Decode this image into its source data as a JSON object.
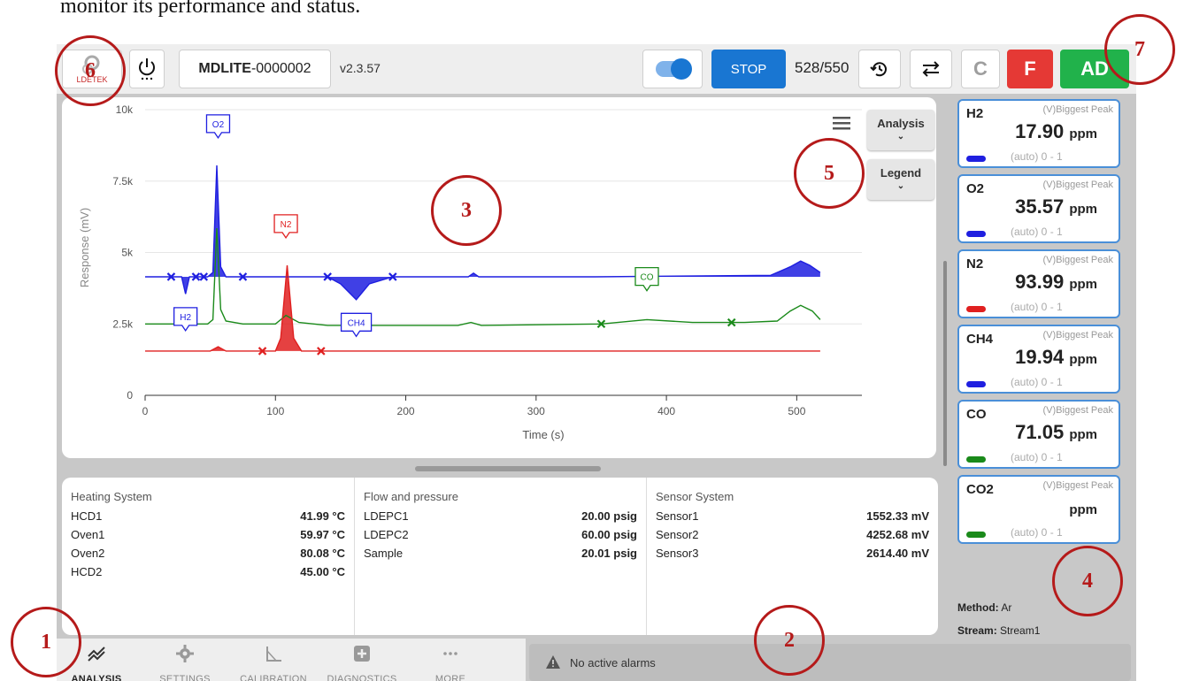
{
  "caption": "monitor its performance and status.",
  "topbar": {
    "logo_text": "LDETEK",
    "device_prefix": "MDLITE",
    "device_id": "-0000002",
    "version": "v2.3.57",
    "stop_label": "STOP",
    "counter": "528/550",
    "c_label": "C",
    "f_label": "F",
    "ad_label": "AD"
  },
  "chart": {
    "menu_icon": "hamburger-icon",
    "analysis_label": "Analysis",
    "legend_label": "Legend",
    "ylabel": "Response (mV)",
    "xlabel": "Time (s)",
    "yticks": [
      "0",
      "2.5k",
      "5k",
      "7.5k",
      "10k"
    ],
    "xticks": [
      "0",
      "100",
      "200",
      "300",
      "400",
      "500"
    ]
  },
  "chart_data": {
    "type": "line",
    "xlabel": "Time (s)",
    "ylabel": "Response (mV)",
    "xlim": [
      0,
      550
    ],
    "ylim": [
      0,
      10000
    ],
    "grid": true,
    "series": [
      {
        "color": "#1f1fe0",
        "points": [
          [
            0,
            4150
          ],
          [
            20,
            4150
          ],
          [
            28,
            4150
          ],
          [
            31,
            3550
          ],
          [
            34,
            4150
          ],
          [
            48,
            4150
          ],
          [
            52,
            4300
          ],
          [
            55,
            8050
          ],
          [
            58,
            4500
          ],
          [
            62,
            4150
          ],
          [
            140,
            4150
          ],
          [
            150,
            3900
          ],
          [
            162,
            3350
          ],
          [
            172,
            3900
          ],
          [
            190,
            4150
          ],
          [
            248,
            4150
          ],
          [
            252,
            4280
          ],
          [
            256,
            4150
          ],
          [
            345,
            4150
          ],
          [
            480,
            4200
          ],
          [
            495,
            4500
          ],
          [
            503,
            4700
          ],
          [
            510,
            4550
          ],
          [
            518,
            4300
          ]
        ]
      },
      {
        "color": "#1a8a1a",
        "points": [
          [
            0,
            2500
          ],
          [
            48,
            2500
          ],
          [
            52,
            2650
          ],
          [
            55,
            5850
          ],
          [
            58,
            3000
          ],
          [
            62,
            2600
          ],
          [
            75,
            2500
          ],
          [
            100,
            2500
          ],
          [
            108,
            2800
          ],
          [
            118,
            2550
          ],
          [
            140,
            2450
          ],
          [
            240,
            2450
          ],
          [
            250,
            2550
          ],
          [
            258,
            2450
          ],
          [
            350,
            2500
          ],
          [
            385,
            2650
          ],
          [
            420,
            2550
          ],
          [
            460,
            2550
          ],
          [
            485,
            2600
          ],
          [
            495,
            2950
          ],
          [
            503,
            3150
          ],
          [
            512,
            2950
          ],
          [
            518,
            2650
          ]
        ]
      },
      {
        "color": "#e02020",
        "points": [
          [
            0,
            1550
          ],
          [
            50,
            1550
          ],
          [
            56,
            1700
          ],
          [
            62,
            1550
          ],
          [
            100,
            1550
          ],
          [
            104,
            2000
          ],
          [
            109,
            4550
          ],
          [
            114,
            2000
          ],
          [
            120,
            1550
          ],
          [
            518,
            1550
          ]
        ]
      }
    ],
    "peak_labels": [
      {
        "text": "O2",
        "x": 56,
        "y": 9200,
        "color": "#1f1fe0"
      },
      {
        "text": "N2",
        "x": 108,
        "y": 5700,
        "color": "#e02020"
      },
      {
        "text": "H2",
        "x": 31,
        "y": 2450,
        "color": "#1f1fe0"
      },
      {
        "text": "CH4",
        "x": 162,
        "y": 2250,
        "color": "#1f1fe0"
      },
      {
        "text": "CO",
        "x": 385,
        "y": 3850,
        "color": "#1a8a1a"
      }
    ],
    "markers": [
      {
        "x": 20,
        "y": 4150,
        "color": "#1f1fe0"
      },
      {
        "x": 39,
        "y": 4150,
        "color": "#1f1fe0"
      },
      {
        "x": 45,
        "y": 4150,
        "color": "#1f1fe0"
      },
      {
        "x": 75,
        "y": 4150,
        "color": "#1f1fe0"
      },
      {
        "x": 140,
        "y": 4150,
        "color": "#1f1fe0"
      },
      {
        "x": 190,
        "y": 4150,
        "color": "#1f1fe0"
      },
      {
        "x": 350,
        "y": 2500,
        "color": "#1a8a1a"
      },
      {
        "x": 450,
        "y": 2550,
        "color": "#1a8a1a"
      },
      {
        "x": 90,
        "y": 1550,
        "color": "#e02020"
      },
      {
        "x": 135,
        "y": 1550,
        "color": "#e02020"
      }
    ]
  },
  "info": {
    "heating": {
      "title": "Heating System",
      "rows": [
        {
          "label": "HCD1",
          "value": "41.99 °C"
        },
        {
          "label": "Oven1",
          "value": "59.97 °C"
        },
        {
          "label": "Oven2",
          "value": "80.08 °C"
        },
        {
          "label": "HCD2",
          "value": "45.00 °C"
        }
      ]
    },
    "flow": {
      "title": "Flow and pressure",
      "rows": [
        {
          "label": "LDEPC1",
          "value": "20.00 psig"
        },
        {
          "label": "LDEPC2",
          "value": "60.00 psig"
        },
        {
          "label": "Sample",
          "value": "20.01 psig"
        }
      ]
    },
    "sensor": {
      "title": "Sensor System",
      "rows": [
        {
          "label": "Sensor1",
          "value": "1552.33 mV"
        },
        {
          "label": "Sensor2",
          "value": "4252.68 mV"
        },
        {
          "label": "Sensor3",
          "value": "2614.40 mV"
        }
      ]
    }
  },
  "cards": [
    {
      "name": "H2",
      "mode": "(V)Biggest Peak",
      "value": "17.90",
      "unit": "ppm",
      "range": "(auto) 0 - 1",
      "color": "#1f1fe0"
    },
    {
      "name": "O2",
      "mode": "(V)Biggest Peak",
      "value": "35.57",
      "unit": "ppm",
      "range": "(auto) 0 - 1",
      "color": "#1f1fe0"
    },
    {
      "name": "N2",
      "mode": "(V)Biggest Peak",
      "value": "93.99",
      "unit": "ppm",
      "range": "(auto) 0 - 1",
      "color": "#e02020"
    },
    {
      "name": "CH4",
      "mode": "(V)Biggest Peak",
      "value": "19.94",
      "unit": "ppm",
      "range": "(auto) 0 - 1",
      "color": "#1f1fe0"
    },
    {
      "name": "CO",
      "mode": "(V)Biggest Peak",
      "value": "71.05",
      "unit": "ppm",
      "range": "(auto) 0 - 1",
      "color": "#1a8a1a"
    },
    {
      "name": "CO2",
      "mode": "(V)Biggest Peak",
      "value": "",
      "unit": "ppm",
      "range": "(auto) 0 - 1",
      "color": "#1a8a1a"
    }
  ],
  "method": {
    "label": "Method:",
    "value": "Ar"
  },
  "stream": {
    "label": "Stream:",
    "value": "Stream1"
  },
  "nav": [
    {
      "label": "ANALYSIS",
      "icon": "trend-icon"
    },
    {
      "label": "SETTINGS",
      "icon": "gear-icon"
    },
    {
      "label": "CALIBRATION",
      "icon": "calibration-icon"
    },
    {
      "label": "DIAGNOSTICS",
      "icon": "diagnostics-plus-icon"
    },
    {
      "label": "MORE",
      "icon": "more-dots-icon"
    }
  ],
  "alarm": {
    "text": "No active alarms"
  },
  "callouts": [
    "1",
    "2",
    "3",
    "4",
    "5",
    "6",
    "7"
  ]
}
